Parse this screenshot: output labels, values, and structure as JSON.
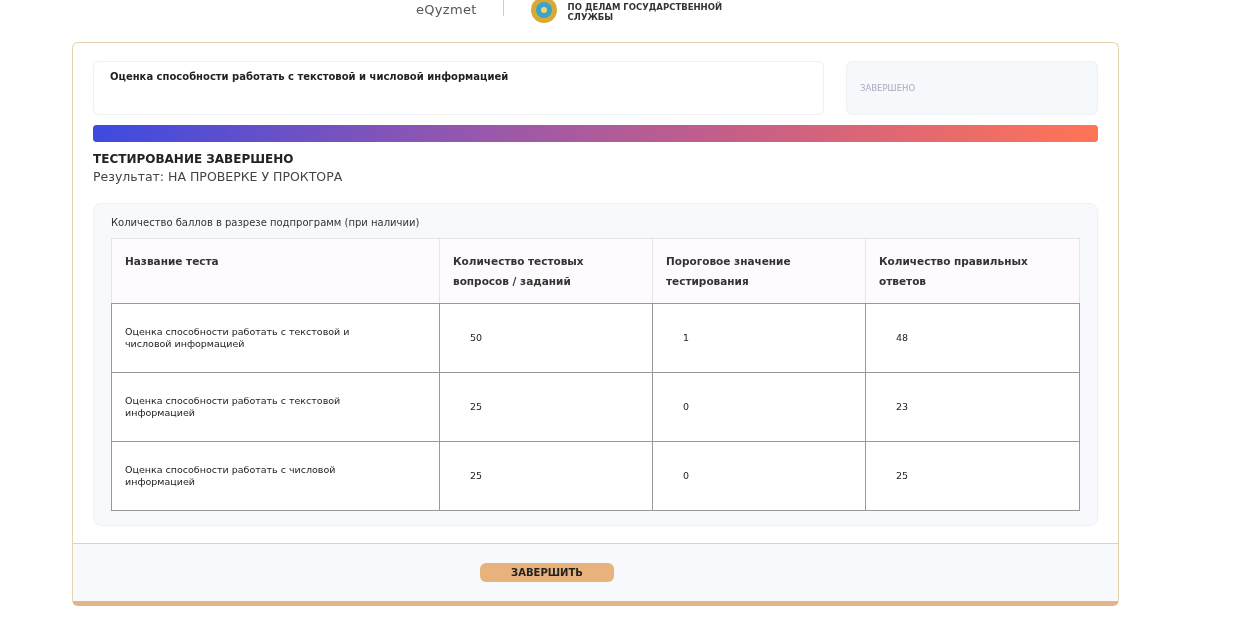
{
  "header": {
    "brand": "eQyzmet",
    "agency_lines": [
      "ПО ДЕЛАМ ГОСУДАРСТВЕННОЙ",
      "СЛУЖБЫ"
    ]
  },
  "test": {
    "title": "Оценка способности работать с текстовой и числовой информацией",
    "status": "ЗАВЕРШЕНО"
  },
  "result": {
    "heading": "ТЕСТИРОВАНИЕ ЗАВЕРШЕНО",
    "text": "Результат: НА ПРОВЕРКЕ У ПРОКТОРА"
  },
  "scores": {
    "caption": "Количество баллов в разрезе подпрограмм (при наличии)",
    "columns": [
      "Название теста",
      "Количество тестовых вопросов / заданий",
      "Пороговое значение тестирования",
      "Количество правильных  ответов"
    ],
    "rows": [
      [
        "Оценка способности работать с текстовой и числовой информацией",
        "50",
        "1",
        "48"
      ],
      [
        "Оценка способности работать с текстовой информацией",
        "25",
        "0",
        "23"
      ],
      [
        "Оценка способности работать с числовой информацией",
        "25",
        "0",
        "25"
      ]
    ]
  },
  "finish_button": "ЗАВЕРШИТЬ"
}
